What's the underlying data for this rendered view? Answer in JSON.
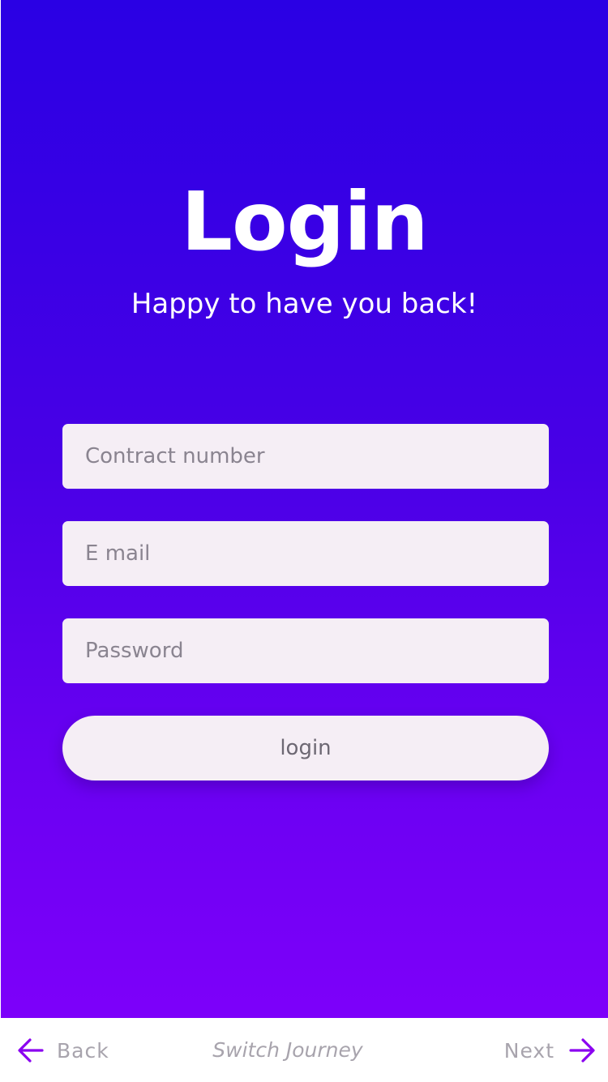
{
  "login": {
    "title": "Login",
    "subtitle": "Happy to have you back!",
    "contract_placeholder": "Contract number",
    "email_placeholder": "E mail",
    "password_placeholder": "Password",
    "button_label": "login"
  },
  "bottom_nav": {
    "back_label": "Back",
    "switch_label": "Switch Journey",
    "next_label": "Next",
    "back_icon": "arrow-left-icon",
    "next_icon": "arrow-right-icon"
  },
  "colors": {
    "gradient_top": "#2a00e4",
    "gradient_bottom": "#7d00fa",
    "field_background": "#f5eef5",
    "arrow_color": "#8a00f0",
    "nav_text": "#a8a4ad"
  }
}
